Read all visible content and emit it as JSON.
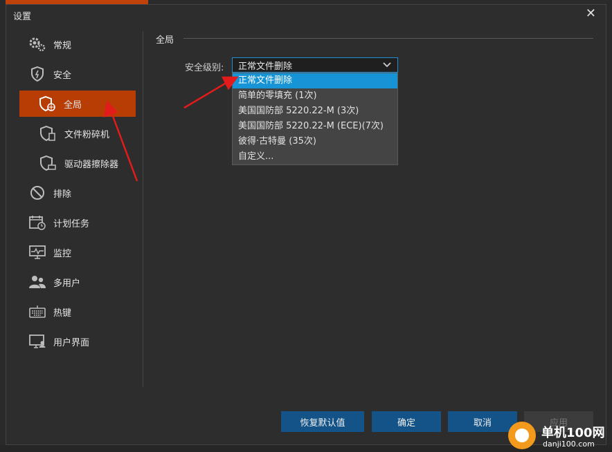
{
  "dialog": {
    "title": "设置"
  },
  "nav": {
    "items": [
      {
        "label": "常规",
        "icon": "gear-icon"
      },
      {
        "label": "安全",
        "icon": "shield-icon"
      },
      {
        "label": "全局",
        "icon": "shield-globe-icon"
      },
      {
        "label": "文件粉碎机",
        "icon": "shield-file-icon"
      },
      {
        "label": "驱动器擦除器",
        "icon": "shield-drive-icon"
      },
      {
        "label": "排除",
        "icon": "ban-icon"
      },
      {
        "label": "计划任务",
        "icon": "calendar-clock-icon"
      },
      {
        "label": "监控",
        "icon": "monitor-icon"
      },
      {
        "label": "多用户",
        "icon": "users-icon"
      },
      {
        "label": "热键",
        "icon": "keyboard-icon"
      },
      {
        "label": "用户界面",
        "icon": "display-user-icon"
      }
    ],
    "active": "全局"
  },
  "section": {
    "title": "全局"
  },
  "security_level": {
    "label": "安全级别:",
    "value": "正常文件删除",
    "options": [
      "正常文件删除",
      "简单的零填充 (1次)",
      "美国国防部 5220.22-M (3次)",
      "美国国防部 5220.22-M (ECE)(7次)",
      "彼得·古特曼 (35次)",
      "自定义..."
    ]
  },
  "buttons": {
    "restore": "恢复默认值",
    "ok": "确定",
    "cancel": "取消",
    "apply": "应用"
  },
  "watermark": {
    "name": "单机100网",
    "url": "danji100.com"
  },
  "colors": {
    "accent": "#b83d05",
    "selection": "#1694d6",
    "button": "#135387"
  }
}
